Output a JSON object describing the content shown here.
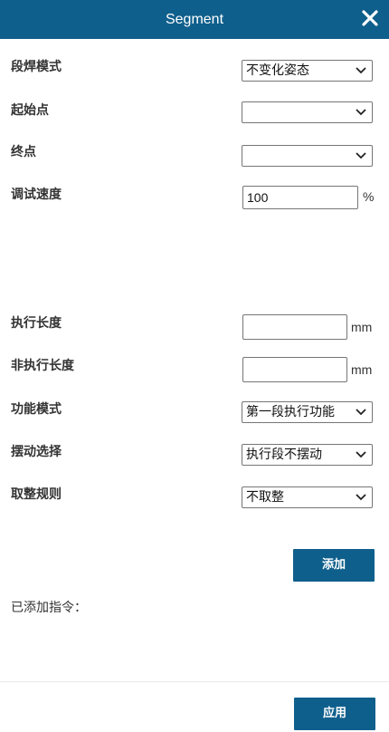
{
  "header": {
    "title": "Segment",
    "close_icon": "close-icon"
  },
  "fields": {
    "weld_mode": {
      "label": "段焊模式",
      "value": "不变化姿态"
    },
    "start_point": {
      "label": "起始点",
      "value": ""
    },
    "end_point": {
      "label": "终点",
      "value": ""
    },
    "debug_speed": {
      "label": "调试速度",
      "value": "100",
      "unit": "%"
    },
    "exec_length": {
      "label": "执行长度",
      "value": "",
      "unit": "mm"
    },
    "non_exec_length": {
      "label": "非执行长度",
      "value": "",
      "unit": "mm"
    },
    "function_mode": {
      "label": "功能模式",
      "value": "第一段执行功能"
    },
    "swing_select": {
      "label": "摆动选择",
      "value": "执行段不摆动"
    },
    "rounding_rule": {
      "label": "取整规则",
      "value": "不取整"
    }
  },
  "actions": {
    "add_label": "添加",
    "apply_label": "应用"
  },
  "added_instructions": {
    "label": "已添加指令："
  },
  "colors": {
    "header_bg": "#0f5f8c",
    "button_bg": "#0f5f8c"
  }
}
